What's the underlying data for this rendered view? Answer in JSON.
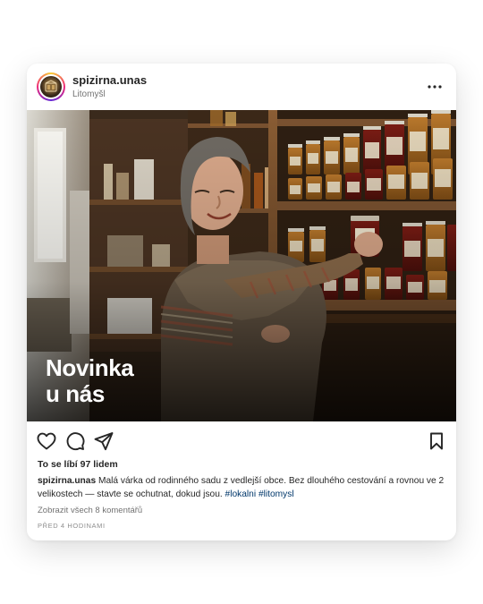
{
  "post": {
    "username": "spizirna.unas",
    "location": "Litomyšl",
    "overlay_title_line1": "Novinka",
    "overlay_title_line2": "u nás",
    "likes": "To se líbí 97 lidem",
    "caption_username": "spizirna.unas",
    "caption_text": "Malá várka od rodinného sadu z vedlejší obce. Bez dlouhého cestování a rovnou ve 2 velikostech — stavte se ochutnat, dokud jsou.",
    "hashtags": [
      "#lokalni",
      "#litomysl"
    ],
    "view_comments": "Zobrazit všech 8 komentářů",
    "timestamp": "PŘED 4 HODINAMI"
  },
  "icons": {
    "avatar": "avatar",
    "more": "more-icon",
    "like": "heart-icon",
    "comment": "comment-icon",
    "share": "send-icon",
    "save": "bookmark-icon"
  },
  "colors": {
    "hashtag": "#00376b",
    "text": "#262626",
    "muted": "#737373"
  }
}
